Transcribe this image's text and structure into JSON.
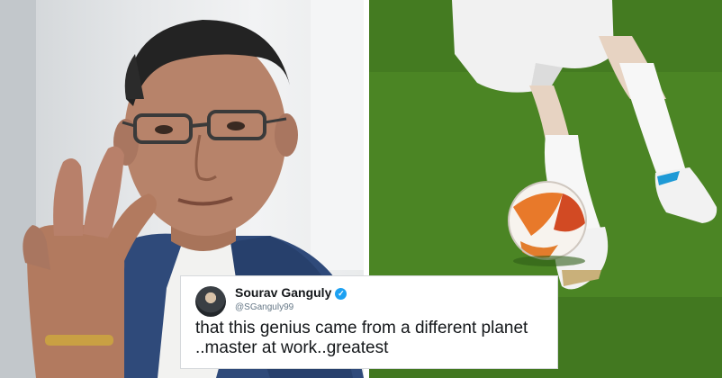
{
  "tweet": {
    "name": "Sourav Ganguly",
    "handle": "@SGanguly99",
    "text_line1": "that this genius came from a different planet",
    "text_line2": "..master at work..greatest",
    "verified_icon": "verified-badge-icon"
  },
  "colors": {
    "card_background": "#ffffff",
    "verified_badge": "#1da1f2",
    "pitch_green": "#4a8422"
  }
}
